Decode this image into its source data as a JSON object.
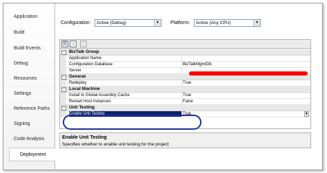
{
  "sidebar": {
    "items": [
      {
        "label": "Application"
      },
      {
        "label": "Build"
      },
      {
        "label": "Build Events"
      },
      {
        "label": "Debug"
      },
      {
        "label": "Resources"
      },
      {
        "label": "Settings"
      },
      {
        "label": "Reference Paths"
      },
      {
        "label": "Signing"
      },
      {
        "label": "Code Analysis"
      },
      {
        "label": "Deployment"
      }
    ],
    "active": "Deployment"
  },
  "config": {
    "configuration_label": "Configuration:",
    "configuration_value": "Active (Debug)",
    "platform_label": "Platform:",
    "platform_value": "Active (Any CPU)"
  },
  "grid": {
    "categories": [
      {
        "name": "BizTalk Group",
        "rows": [
          {
            "name": "Application Name",
            "value": ""
          },
          {
            "name": "Configuration Database",
            "value": "BizTalkMgmtDb"
          },
          {
            "name": "Server",
            "value": ""
          }
        ]
      },
      {
        "name": "General",
        "rows": [
          {
            "name": "Redeploy",
            "value": "True"
          }
        ]
      },
      {
        "name": "Local Machine",
        "rows": [
          {
            "name": "Install to Global Assembly Cache",
            "value": "True"
          },
          {
            "name": "Restart Host Instances",
            "value": "False"
          }
        ]
      },
      {
        "name": "Unit Testing",
        "rows": [
          {
            "name": "Enable Unit Testing",
            "value": "True"
          }
        ]
      }
    ]
  },
  "description": {
    "title": "Enable Unit Testing",
    "text": "Specifies whether to enable unit testing for the project"
  },
  "colors": {
    "selection": "#0a246a",
    "highlight_oval": "#1b2d8f",
    "redaction": "#ff0000"
  }
}
